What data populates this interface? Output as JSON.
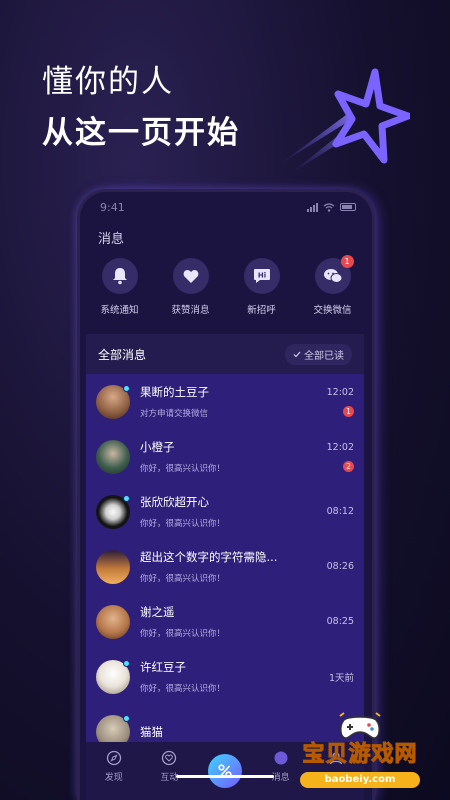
{
  "headline": {
    "line1": "懂你的人",
    "line2": "从这一页开始"
  },
  "status": {
    "time": "9:41"
  },
  "page_title": "消息",
  "quick_actions": [
    {
      "label": "系统通知",
      "icon": "bell-icon"
    },
    {
      "label": "获赞消息",
      "icon": "heart-icon"
    },
    {
      "label": "新招呼",
      "icon": "hi-bubble-icon"
    },
    {
      "label": "交换微信",
      "icon": "wechat-icon",
      "badge": "1"
    }
  ],
  "list_header": {
    "title": "全部消息",
    "read_all": "全部已读"
  },
  "messages": [
    {
      "name": "果断的土豆子",
      "msg": "对方申请交换微信",
      "time": "12:02",
      "badge": "1",
      "online": true,
      "avatar_color": "#8a5b3e"
    },
    {
      "name": "小橙子",
      "msg": "你好，很高兴认识你！",
      "time": "12:02",
      "badge": "2",
      "online": false,
      "avatar_color": "#3d5d4c"
    },
    {
      "name": "张欣欣超开心",
      "msg": "你好，很高兴认识你！",
      "time": "08:12",
      "online": true,
      "avatar_color": "#141414"
    },
    {
      "name": "超出这个数字的字符需隐...",
      "msg": "你好，很高兴认识你！",
      "time": "08:26",
      "online": false,
      "avatar_color": "#c27a3a"
    },
    {
      "name": "谢之遥",
      "msg": "你好，很高兴认识你！",
      "time": "08:25",
      "online": false,
      "avatar_color": "#b5764a"
    },
    {
      "name": "许红豆子",
      "msg": "你好，很高兴认识你！",
      "time": "1天前",
      "online": true,
      "avatar_color": "#e9e2d8"
    },
    {
      "name": "猫猫",
      "msg": "",
      "time": "",
      "online": true,
      "avatar_color": "#9a8d7c"
    }
  ],
  "tabs": [
    {
      "label": "发现",
      "icon": "compass-icon"
    },
    {
      "label": "互动",
      "icon": "heart-outline-icon"
    },
    {
      "label": "",
      "icon": "percent-center-icon"
    },
    {
      "label": "消息",
      "icon": "message-icon"
    },
    {
      "label": "我的",
      "icon": "profile-icon"
    }
  ],
  "watermark": {
    "text": "宝贝游戏网",
    "url": "baobeiy.com"
  },
  "colors": {
    "accent": "#7a58ff",
    "badge": "#e8494e",
    "online": "#4be3ff"
  }
}
